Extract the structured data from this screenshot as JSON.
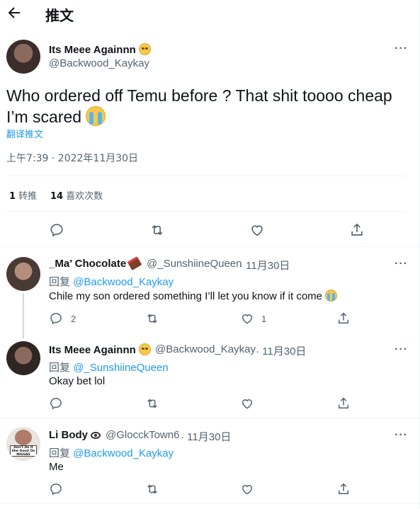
{
  "header": {
    "title": "推文"
  },
  "main_tweet": {
    "name": "Its Meee Againnn",
    "handle": "@Backwood_Kaykay",
    "text": "Who ordered off Temu before ? That shit toooo cheap I’m scared",
    "translate": "翻译推文",
    "timestamp": "上午7:39 · 2022年11月30日",
    "retweets_count": "1",
    "retweets_label": "转推",
    "likes_count": "14",
    "likes_label": "喜欢次数"
  },
  "replies": [
    {
      "name": "_Ma’ Chocolate",
      "handle": "@_SunshiineQueen",
      "date": "· 11月30日",
      "reply_prefix": "回复",
      "reply_to": "@Backwood_Kaykay",
      "text": "Chile my son ordered something I’ll let you know if it come",
      "reply_count": "2",
      "like_count": "1"
    },
    {
      "name": "Its Meee Againnn",
      "handle": "@Backwood_Kaykay",
      "date": "· 11月30日",
      "reply_prefix": "回复",
      "reply_to": "@_SunshiineQueen",
      "text": "Okay bet lol"
    },
    {
      "name": "Li Body",
      "handle": "@GlocckTown6",
      "date": "· 11月30日",
      "reply_prefix": "回复",
      "reply_to": "@Backwood_Kaykay",
      "text": "Me",
      "avatar_sign": "Don't Do It She Good On NIGGAS"
    }
  ],
  "colors": {
    "accent": "#1d9bf0",
    "muted": "#536471",
    "text": "#0f1419",
    "divider": "#eff3f4"
  },
  "icons": [
    "back-arrow-icon",
    "more-icon",
    "reply-icon",
    "retweet-icon",
    "like-icon",
    "share-icon"
  ]
}
